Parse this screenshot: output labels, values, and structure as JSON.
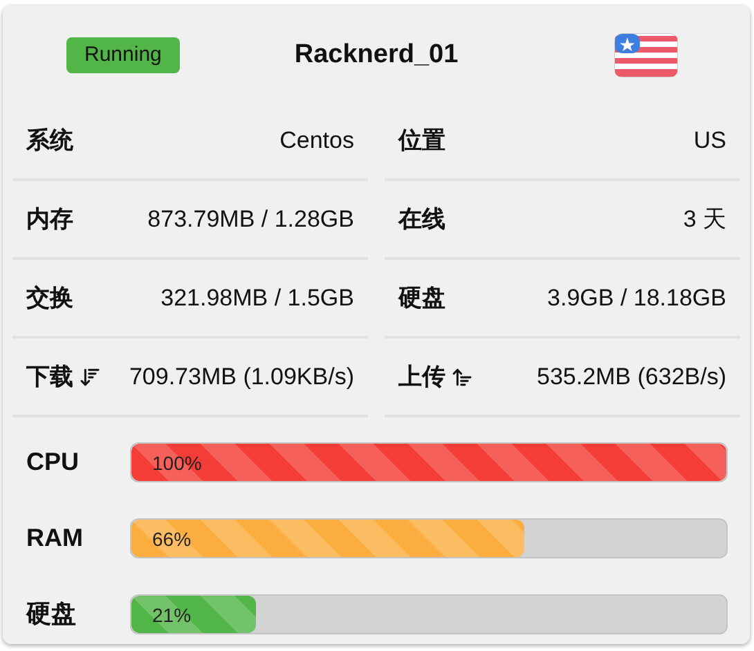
{
  "status": {
    "label": "Running"
  },
  "server": {
    "name": "Racknerd_01"
  },
  "stats": [
    {
      "kind": "plain",
      "label": "系统",
      "value": "Centos"
    },
    {
      "kind": "plain",
      "label": "位置",
      "value": "US"
    },
    {
      "kind": "plain",
      "label": "内存",
      "value": "873.79MB / 1.28GB"
    },
    {
      "kind": "plain",
      "label": "在线",
      "value": "3 天"
    },
    {
      "kind": "plain",
      "label": "交换",
      "value": "321.98MB / 1.5GB"
    },
    {
      "kind": "plain",
      "label": "硬盘",
      "value": "3.9GB / 18.18GB"
    },
    {
      "kind": "download",
      "label": "下载",
      "value": "709.73MB (1.09KB/s)"
    },
    {
      "kind": "upload",
      "label": "上传",
      "value": "535.2MB (632B/s)"
    }
  ],
  "meters": [
    {
      "label": "CPU",
      "level": 1.0,
      "reading": "100%",
      "color": "#f33d36"
    },
    {
      "label": "RAM",
      "level": 0.66,
      "reading": "66%",
      "color": "#fbad3f"
    },
    {
      "label": "硬盘",
      "level": 0.21,
      "reading": "21%",
      "color": "#52b548"
    }
  ]
}
